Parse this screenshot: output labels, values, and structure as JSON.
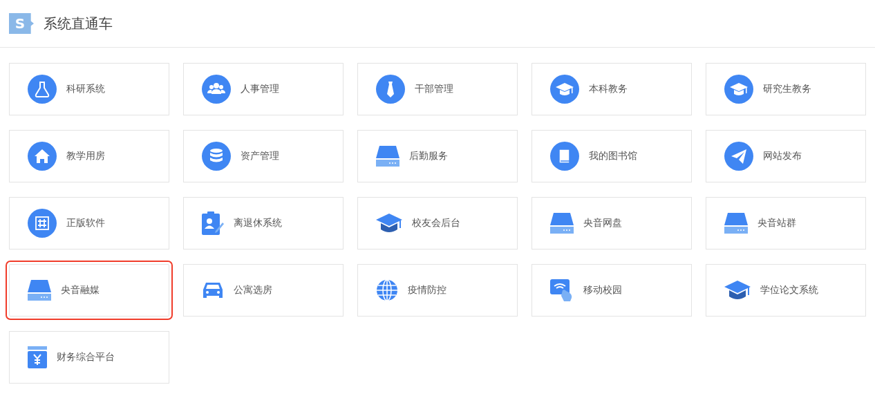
{
  "header": {
    "logo": "S",
    "title": "系统直通车"
  },
  "tiles": [
    {
      "label": "科研系统",
      "highlighted": false
    },
    {
      "label": "人事管理",
      "highlighted": false
    },
    {
      "label": "干部管理",
      "highlighted": false
    },
    {
      "label": "本科教务",
      "highlighted": false
    },
    {
      "label": "研究生教务",
      "highlighted": false
    },
    {
      "label": "教学用房",
      "highlighted": false
    },
    {
      "label": "资产管理",
      "highlighted": false
    },
    {
      "label": "后勤服务",
      "highlighted": false
    },
    {
      "label": "我的图书馆",
      "highlighted": false
    },
    {
      "label": "网站发布",
      "highlighted": false
    },
    {
      "label": "正版软件",
      "highlighted": false
    },
    {
      "label": "离退休系统",
      "highlighted": false
    },
    {
      "label": "校友会后台",
      "highlighted": false
    },
    {
      "label": "央音网盘",
      "highlighted": false
    },
    {
      "label": "央音站群",
      "highlighted": false
    },
    {
      "label": "央音融媒",
      "highlighted": true
    },
    {
      "label": "公寓选房",
      "highlighted": false
    },
    {
      "label": "疫情防控",
      "highlighted": false
    },
    {
      "label": "移动校园",
      "highlighted": false
    },
    {
      "label": "学位论文系统",
      "highlighted": false
    },
    {
      "label": "财务综合平台",
      "highlighted": false
    }
  ]
}
